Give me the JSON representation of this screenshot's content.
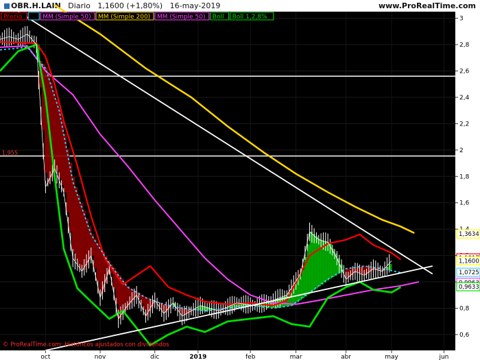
{
  "header": {
    "symbol": "OBR.H.LAIN",
    "period": "Diario",
    "last_quote": "1,1600 (+1,80%)",
    "date": "16-may-2019",
    "brand": "www.ProRealTime.com"
  },
  "footer_note": "© ProRealTime.com: Históricos ajustados con dividendos",
  "colors": {
    "background": "#000000",
    "price": "#ffffff",
    "sma20": "#ffff00",
    "sma200": "#ffd700",
    "sma50": "#ff40ff",
    "upper_band": "#ff0000",
    "lower_band": "#00e000",
    "mid_band": "#40d0ff",
    "cloud_down": "#8b0000",
    "cloud_up": "#00b000",
    "trend": "#ffffff"
  },
  "chart_data": {
    "type": "line",
    "x": [
      "oct",
      "nov",
      "dic",
      "2019",
      "feb",
      "mar",
      "abr",
      "may",
      "jun"
    ],
    "yticks": [
      "3",
      "2,8",
      "2,6",
      "2,4",
      "2,2",
      "2",
      "1,8",
      "1,6",
      "1,4",
      "1,2",
      "1",
      "0,8",
      "0,6"
    ],
    "ylim": [
      0.48,
      3.05
    ],
    "legend": [
      {
        "label": "Precio",
        "color": "#ff0000"
      },
      {
        "label": "",
        "color": "#40d0ff"
      },
      {
        "label": "MM (Simple 50)",
        "color": "#ff40ff"
      },
      {
        "label": "MM (Simple 200)",
        "color": "#ffd700"
      },
      {
        "label": "MM (Simple 50)",
        "color": "#ff40ff"
      },
      {
        "label": "Boll",
        "color": "#00e000"
      },
      {
        "label": "Boll 1,2,8%",
        "color": "#00e000"
      }
    ],
    "horizontal_lines": [
      {
        "value": 2.56,
        "label": ""
      },
      {
        "value": 1.955,
        "label": "1,955"
      }
    ],
    "value_tags": [
      {
        "value": 1.3634,
        "label": "1,3634",
        "color": "#ffff00"
      },
      {
        "value": 1.1817,
        "label": "1,1817",
        "color": "#ff0000"
      },
      {
        "value": 1.16,
        "label": "1,1600",
        "color": "#ffff00"
      },
      {
        "value": 1.0725,
        "label": "1,0725",
        "color": "#40d0ff"
      },
      {
        "value": 0.9963,
        "label": "0,9963",
        "color": "#ff40ff"
      },
      {
        "value": 0.9633,
        "label": "0,9633",
        "color": "#00e000"
      }
    ],
    "series": [
      {
        "name": "MM (Simple 200)",
        "key": "sma200",
        "values": [
          [
            0.12,
            3.1
          ],
          [
            0.22,
            2.88
          ],
          [
            0.32,
            2.62
          ],
          [
            0.42,
            2.4
          ],
          [
            0.5,
            2.18
          ],
          [
            0.58,
            1.98
          ],
          [
            0.65,
            1.82
          ],
          [
            0.72,
            1.68
          ],
          [
            0.78,
            1.57
          ],
          [
            0.84,
            1.47
          ],
          [
            0.88,
            1.42
          ],
          [
            0.91,
            1.37
          ]
        ]
      },
      {
        "name": "MM (Simple 50)",
        "key": "sma50",
        "values": [
          [
            0.0,
            2.78
          ],
          [
            0.06,
            2.79
          ],
          [
            0.1,
            2.6
          ],
          [
            0.16,
            2.42
          ],
          [
            0.22,
            2.12
          ],
          [
            0.28,
            1.88
          ],
          [
            0.34,
            1.62
          ],
          [
            0.4,
            1.38
          ],
          [
            0.45,
            1.18
          ],
          [
            0.5,
            1.02
          ],
          [
            0.55,
            0.9
          ],
          [
            0.6,
            0.84
          ],
          [
            0.65,
            0.83
          ],
          [
            0.7,
            0.86
          ],
          [
            0.76,
            0.9
          ],
          [
            0.82,
            0.94
          ],
          [
            0.88,
            0.97
          ],
          [
            0.92,
            1.0
          ]
        ]
      },
      {
        "name": "Boll",
        "key": "upper",
        "values": [
          [
            0.0,
            2.82
          ],
          [
            0.08,
            2.81
          ],
          [
            0.1,
            2.71
          ],
          [
            0.12,
            2.5
          ],
          [
            0.14,
            2.22
          ],
          [
            0.17,
            1.88
          ],
          [
            0.2,
            1.5
          ],
          [
            0.23,
            1.18
          ],
          [
            0.27,
            0.98
          ],
          [
            0.3,
            1.05
          ],
          [
            0.33,
            1.12
          ],
          [
            0.37,
            0.96
          ],
          [
            0.41,
            0.9
          ],
          [
            0.45,
            0.85
          ],
          [
            0.5,
            0.83
          ],
          [
            0.55,
            0.84
          ],
          [
            0.6,
            0.82
          ],
          [
            0.63,
            0.86
          ],
          [
            0.68,
            1.2
          ],
          [
            0.72,
            1.29
          ],
          [
            0.76,
            1.32
          ],
          [
            0.79,
            1.36
          ],
          [
            0.82,
            1.28
          ],
          [
            0.86,
            1.22
          ],
          [
            0.88,
            1.17
          ]
        ]
      },
      {
        "name": "Boll 1,2,8%",
        "key": "lower",
        "values": [
          [
            0.0,
            2.6
          ],
          [
            0.04,
            2.75
          ],
          [
            0.08,
            2.8
          ],
          [
            0.1,
            2.4
          ],
          [
            0.12,
            1.8
          ],
          [
            0.14,
            1.25
          ],
          [
            0.17,
            0.95
          ],
          [
            0.2,
            0.85
          ],
          [
            0.24,
            0.72
          ],
          [
            0.27,
            0.78
          ],
          [
            0.3,
            0.65
          ],
          [
            0.33,
            0.52
          ],
          [
            0.37,
            0.6
          ],
          [
            0.41,
            0.66
          ],
          [
            0.45,
            0.62
          ],
          [
            0.5,
            0.7
          ],
          [
            0.55,
            0.72
          ],
          [
            0.6,
            0.74
          ],
          [
            0.64,
            0.68
          ],
          [
            0.68,
            0.66
          ],
          [
            0.72,
            0.88
          ],
          [
            0.76,
            0.96
          ],
          [
            0.79,
            1.0
          ],
          [
            0.82,
            0.94
          ],
          [
            0.86,
            0.92
          ],
          [
            0.88,
            0.96
          ]
        ]
      },
      {
        "name": "",
        "key": "mid",
        "values": [
          [
            0.0,
            2.76
          ],
          [
            0.06,
            2.78
          ],
          [
            0.1,
            2.62
          ],
          [
            0.13,
            2.3
          ],
          [
            0.16,
            1.76
          ],
          [
            0.2,
            1.36
          ],
          [
            0.24,
            1.14
          ],
          [
            0.28,
            0.96
          ],
          [
            0.32,
            0.88
          ],
          [
            0.36,
            0.83
          ],
          [
            0.4,
            0.8
          ],
          [
            0.45,
            0.78
          ],
          [
            0.5,
            0.8
          ],
          [
            0.55,
            0.82
          ],
          [
            0.6,
            0.8
          ],
          [
            0.64,
            0.82
          ],
          [
            0.68,
            0.92
          ],
          [
            0.72,
            1.02
          ],
          [
            0.76,
            1.1
          ],
          [
            0.8,
            1.12
          ],
          [
            0.84,
            1.1
          ],
          [
            0.88,
            1.07
          ]
        ]
      },
      {
        "name": "Precio",
        "key": "price",
        "values": [
          [
            0.0,
            2.84
          ],
          [
            0.02,
            2.86
          ],
          [
            0.04,
            2.84
          ],
          [
            0.06,
            2.88
          ],
          [
            0.08,
            2.8
          ],
          [
            0.1,
            1.72
          ],
          [
            0.12,
            1.86
          ],
          [
            0.14,
            1.68
          ],
          [
            0.16,
            1.18
          ],
          [
            0.18,
            1.08
          ],
          [
            0.2,
            1.2
          ],
          [
            0.22,
            0.88
          ],
          [
            0.24,
            1.1
          ],
          [
            0.26,
            0.72
          ],
          [
            0.28,
            0.82
          ],
          [
            0.3,
            0.9
          ],
          [
            0.32,
            0.74
          ],
          [
            0.34,
            0.86
          ],
          [
            0.36,
            0.76
          ],
          [
            0.38,
            0.84
          ],
          [
            0.4,
            0.74
          ],
          [
            0.44,
            0.82
          ],
          [
            0.48,
            0.78
          ],
          [
            0.52,
            0.84
          ],
          [
            0.56,
            0.82
          ],
          [
            0.6,
            0.86
          ],
          [
            0.63,
            0.9
          ],
          [
            0.66,
            1.06
          ],
          [
            0.68,
            1.38
          ],
          [
            0.7,
            1.32
          ],
          [
            0.72,
            1.3
          ],
          [
            0.74,
            1.18
          ],
          [
            0.76,
            1.02
          ],
          [
            0.78,
            1.08
          ],
          [
            0.8,
            1.05
          ],
          [
            0.82,
            1.1
          ],
          [
            0.84,
            1.08
          ],
          [
            0.86,
            1.16
          ]
        ]
      }
    ],
    "trendlines": [
      {
        "from": [
          0.04,
          3.05
        ],
        "to": [
          0.95,
          1.06
        ]
      },
      {
        "from": [
          0.1,
          0.48
        ],
        "to": [
          0.95,
          1.12
        ]
      }
    ],
    "xlabel": "",
    "ylabel": ""
  }
}
